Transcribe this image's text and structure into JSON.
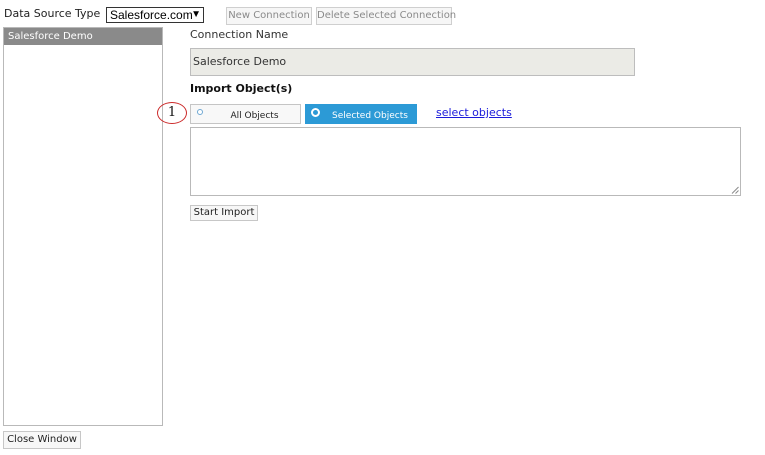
{
  "toolbar": {
    "data_source_label": "Data Source Type",
    "data_source_value": "Salesforce.com",
    "new_connection_label": "New Connection",
    "delete_connection_label": "Delete Selected Connection"
  },
  "sidebar": {
    "items": [
      {
        "label": "Salesforce Demo",
        "selected": true
      }
    ]
  },
  "connection": {
    "name_label": "Connection Name",
    "name_value": "Salesforce Demo"
  },
  "import": {
    "heading": "Import Object(s)",
    "options": [
      {
        "label": "All Objects",
        "selected": false
      },
      {
        "label": "Selected Objects",
        "selected": true
      }
    ],
    "select_link": "select objects",
    "objects_text": "",
    "start_label": "Start Import"
  },
  "annotation": {
    "marker": "1"
  },
  "footer": {
    "close_label": "Close Window"
  },
  "colors": {
    "accent": "#2c9ad6",
    "sidebar_selected": "#8a8a8a",
    "link": "#1a1adb",
    "marker_ring": "#cc2b2b"
  },
  "icons": {
    "dropdown": "chevron-down-icon",
    "radio": "radio-icon",
    "resize": "resize-handle-icon"
  }
}
